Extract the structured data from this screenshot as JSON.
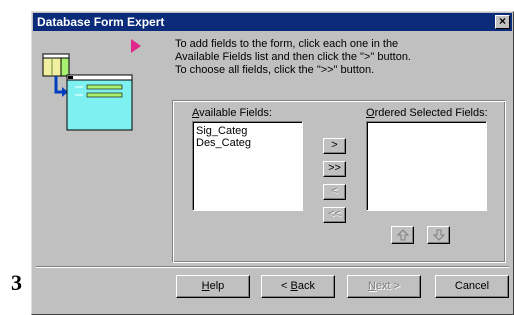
{
  "stray_label": "3",
  "window": {
    "title": "Database Form Expert",
    "close_label": "×"
  },
  "instructions": [
    "To add fields to the form, click each one in the",
    "Available Fields list and then click the \">\" button.",
    "To choose all fields, click the \">>\" button."
  ],
  "available_fields": {
    "label_accel": "A",
    "label_rest": "vailable Fields:",
    "items": [
      "Sig_Categ",
      "Des_Categ"
    ]
  },
  "ordered_fields": {
    "label_accel": "O",
    "label_rest": "rdered Selected Fields:",
    "items": []
  },
  "transfer_buttons": {
    "add_one": ">",
    "add_all": ">>",
    "remove_one": "<",
    "remove_all": "<<"
  },
  "order_buttons": {
    "up_icon": "up-arrow-icon",
    "down_icon": "down-arrow-icon"
  },
  "footer_buttons": {
    "help_accel": "H",
    "help_rest": "elp",
    "back_prefix": "< ",
    "back_accel": "B",
    "back_rest": "ack",
    "next_accel": "N",
    "next_rest": "ext >",
    "cancel": "Cancel"
  },
  "colors": {
    "title_bar": "#0a2a7a",
    "pointer": "#e0288c",
    "form_fill": "#7ff0f0",
    "field_green": "#a8f070"
  }
}
